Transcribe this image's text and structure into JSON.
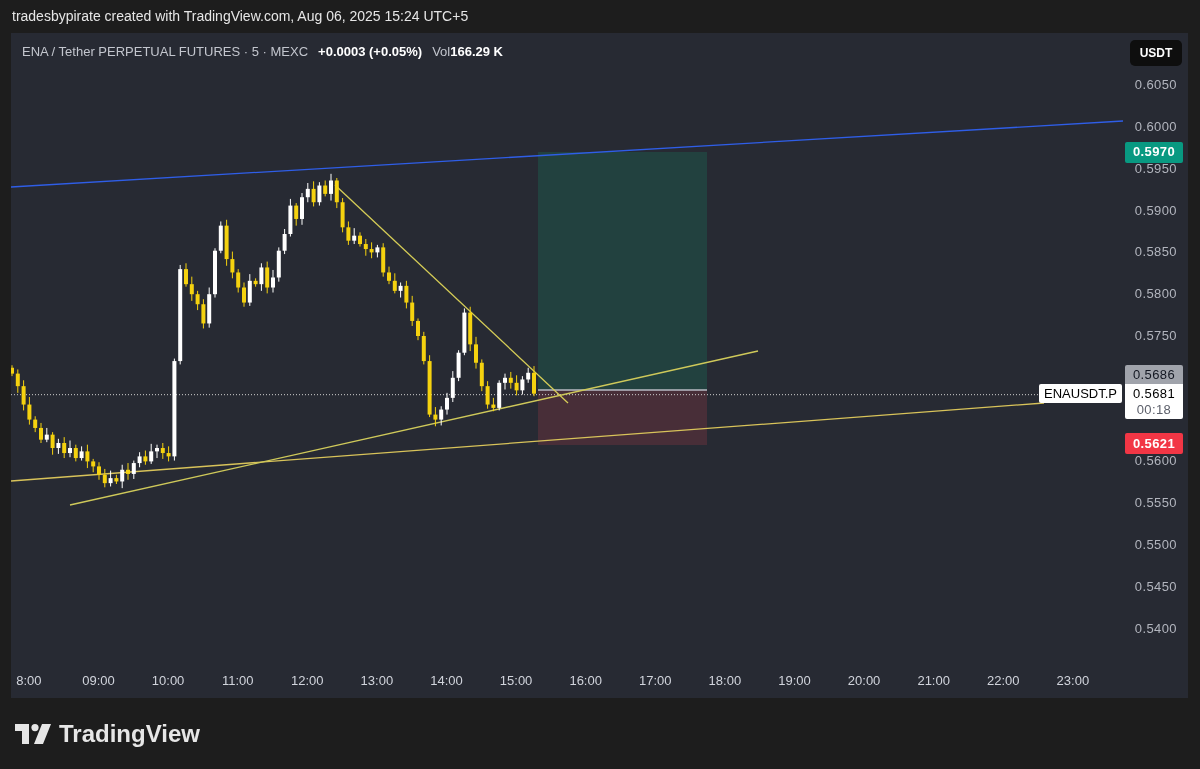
{
  "header": {
    "text": "tradesbypirate created with TradingView.com, Aug 06, 2025 15:24 UTC+5"
  },
  "legend": {
    "symbol": "ENA / Tether PERPETUAL FUTURES · 5 · MEXC",
    "change": "+0.0003 (+0.05%)",
    "volume_label": "Vol",
    "volume": "166.29 K"
  },
  "currency_button": {
    "label": "USDT"
  },
  "price_axis": {
    "labels": [
      "0.6050",
      "0.6000",
      "0.5950",
      "0.5900",
      "0.5850",
      "0.5800",
      "0.5750",
      "0.5600",
      "0.5550",
      "0.5500",
      "0.5450",
      "0.5400"
    ]
  },
  "price_labels": [
    {
      "kind": "target",
      "value": "0.5970",
      "color": "#089981"
    },
    {
      "kind": "entry",
      "value": "0.5686",
      "color": "#a0a3ab"
    },
    {
      "kind": "last",
      "symbol": "ENAUSDT.P",
      "value": "0.5681",
      "countdown": "00:18",
      "color": "#ffffff"
    },
    {
      "kind": "stop",
      "value": "0.5621",
      "color": "#f23645"
    }
  ],
  "time_axis": {
    "labels": [
      "8:00",
      "09:00",
      "10:00",
      "11:00",
      "12:00",
      "13:00",
      "14:00",
      "15:00",
      "16:00",
      "17:00",
      "18:00",
      "19:00",
      "20:00",
      "21:00",
      "22:00",
      "23:00"
    ]
  },
  "footer": {
    "brand": "TradingView"
  }
}
